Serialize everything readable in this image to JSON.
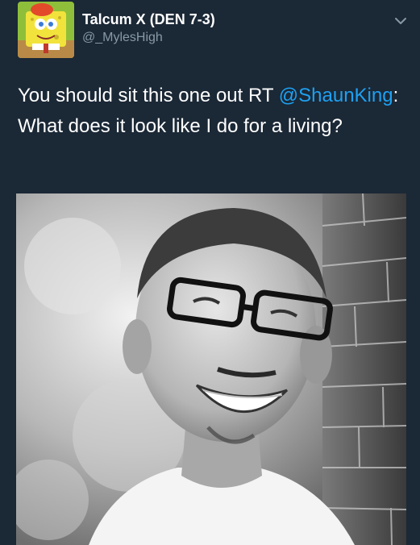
{
  "tweet": {
    "display_name": "Talcum X (DEN 7-3)",
    "handle": "@_MylesHigh",
    "text_before": "You should sit this one out RT ",
    "mention": "@ShaunKing",
    "text_after": ": What does it look like I do for a living?"
  },
  "icons": {
    "menu": "chevron-down-icon"
  },
  "colors": {
    "background": "#1b2836",
    "text": "#ffffff",
    "handle": "#8899a6",
    "link": "#1da1f2"
  }
}
